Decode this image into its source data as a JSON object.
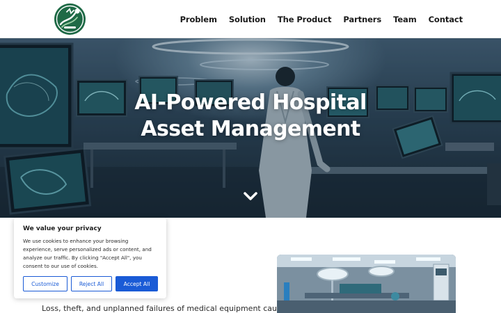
{
  "nav": {
    "items": [
      "Problem",
      "Solution",
      "The Product",
      "Partners",
      "Team",
      "Contact"
    ]
  },
  "hero": {
    "title_line1": "AI-Powered Hospital",
    "title_line2": "Asset Management",
    "scroll_icon": "chevron-down-icon"
  },
  "intro": {
    "text": "Loss, theft, and unplanned failures of medical equipment cause"
  },
  "cookie": {
    "title": "We value your privacy",
    "text": "We use cookies to enhance your browsing experience, serve personalized ads or content, and analyze our traffic. By clicking \"Accept All\", you consent to our use of cookies.",
    "customize_label": "Customize",
    "reject_label": "Reject All",
    "accept_label": "Accept All"
  },
  "colors": {
    "brand_green": "#1f6a46",
    "accent_blue": "#1a5bd6",
    "nav_text": "#1b1b1b"
  }
}
